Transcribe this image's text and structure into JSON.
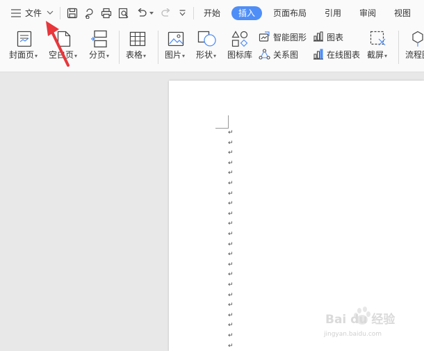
{
  "quick_access": {
    "menu_label": "文件"
  },
  "tabs": {
    "start": "开始",
    "insert": "插入",
    "page_layout": "页面布局",
    "references": "引用",
    "review": "审阅",
    "view": "视图"
  },
  "ribbon": {
    "cover_page": "封面页",
    "blank_page": "空白页",
    "page_break": "分页",
    "table": "表格",
    "picture": "图片",
    "shape": "形状",
    "icon_library": "图标库",
    "smart_art": "智能图形",
    "relation_chart": "关系图",
    "chart": "图表",
    "online_chart": "在线图表",
    "screenshot": "截屏",
    "flowchart": "流程图"
  },
  "document": {
    "paragraph_mark": "↵"
  },
  "watermark": {
    "brand": "Bai du 经验",
    "url": "jingyan.baidu.com"
  },
  "colors": {
    "accent": "#4f8ef7",
    "arrow": "#e8363b"
  }
}
